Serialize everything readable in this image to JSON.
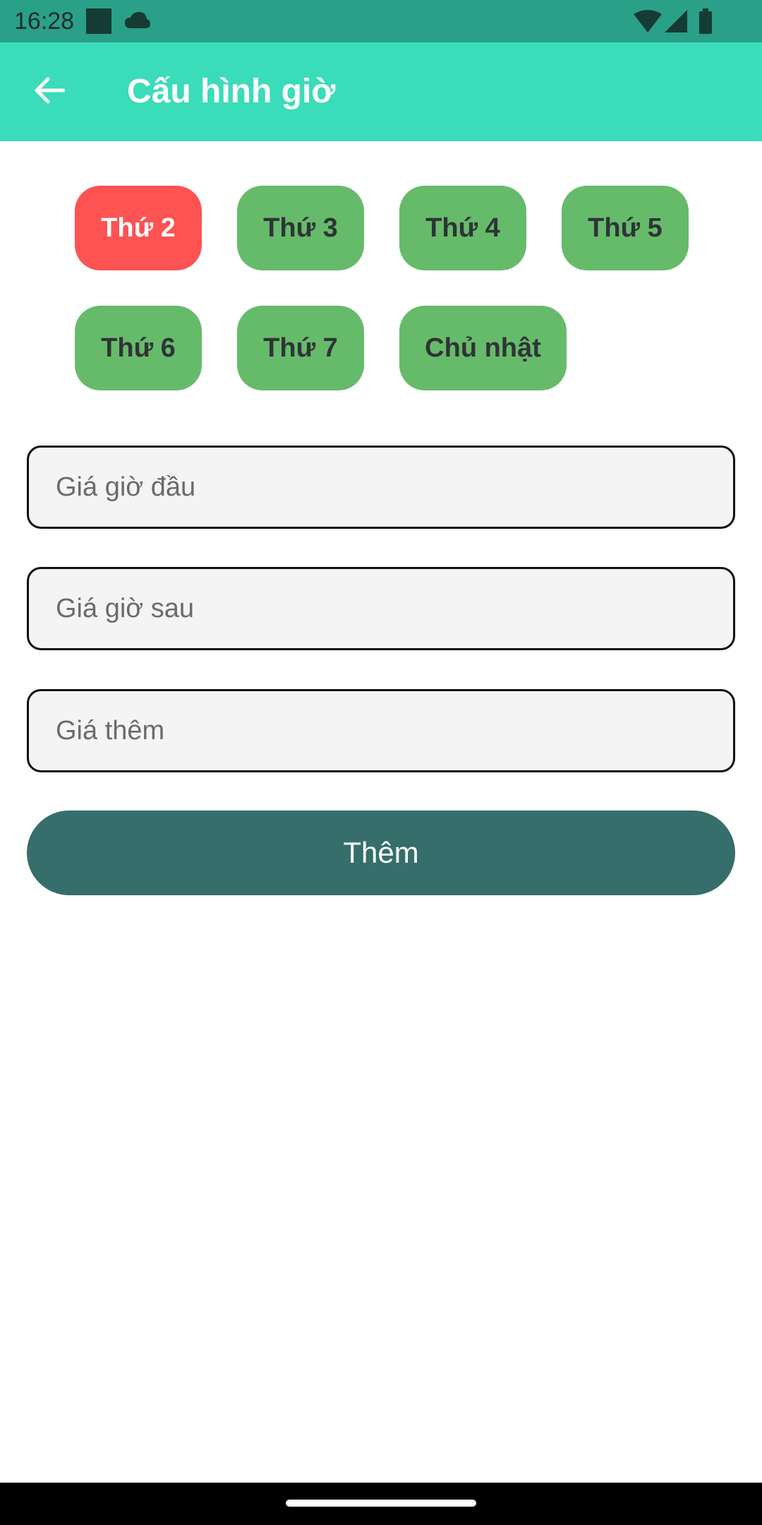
{
  "status_bar": {
    "time": "16:28",
    "icons": [
      "notification-square-icon",
      "cloud-icon",
      "wifi-icon",
      "signal-icon",
      "battery-icon"
    ],
    "background": "#2aa088"
  },
  "app_bar": {
    "title": "Cấu hình giờ",
    "back_icon": "arrow-back-icon",
    "background": "#3adcb9"
  },
  "days": [
    {
      "label": "Thứ 2",
      "selected": true
    },
    {
      "label": "Thứ 3",
      "selected": false
    },
    {
      "label": "Thứ 4",
      "selected": false
    },
    {
      "label": "Thứ 5",
      "selected": false
    },
    {
      "label": "Thứ 6",
      "selected": false
    },
    {
      "label": "Thứ 7",
      "selected": false
    },
    {
      "label": "Chủ nhật",
      "selected": false
    }
  ],
  "form": {
    "first_hour_price": {
      "placeholder": "Giá giờ đầu",
      "value": ""
    },
    "next_hour_price": {
      "placeholder": "Giá giờ sau",
      "value": ""
    },
    "extra_price": {
      "placeholder": "Giá thêm",
      "value": ""
    },
    "submit_label": "Thêm"
  },
  "colors": {
    "chip_default": "#66bb6a",
    "chip_selected": "#ff5252",
    "submit": "#356e6b"
  }
}
